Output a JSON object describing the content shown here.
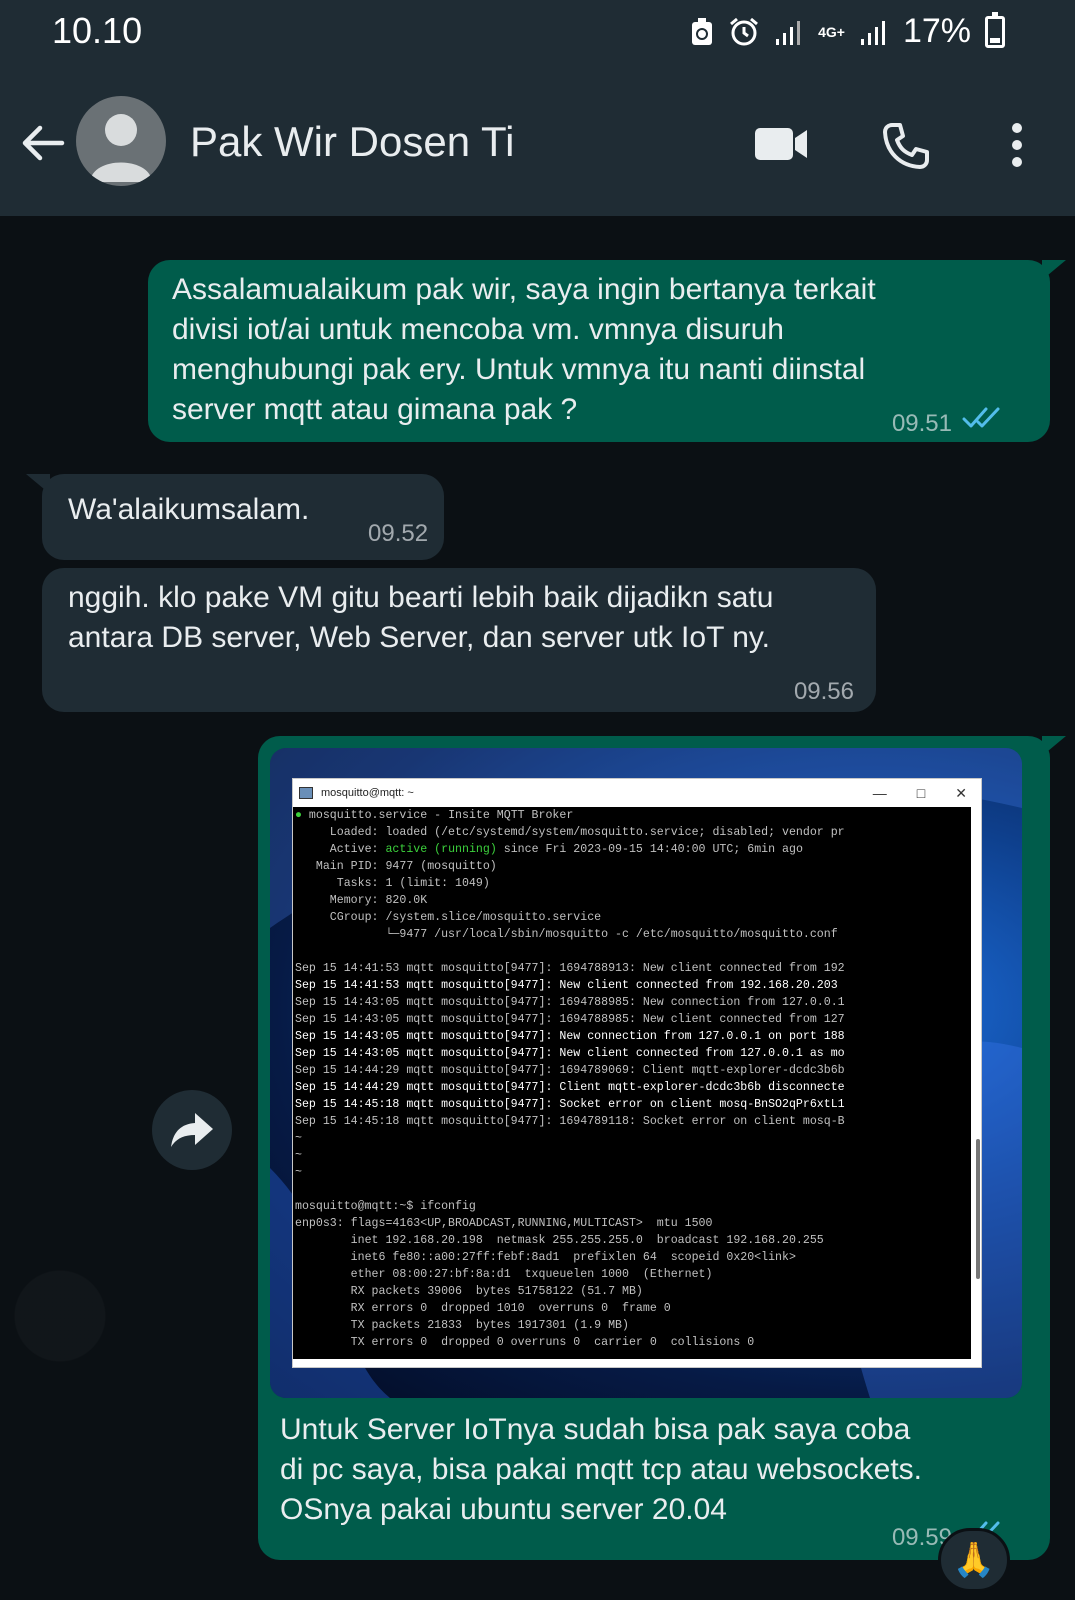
{
  "status_bar": {
    "time": "10.10",
    "network": "4G+",
    "battery": "17%"
  },
  "header": {
    "contact_name": "Pak Wir Dosen Ti",
    "icons": [
      "back-arrow-icon",
      "avatar",
      "video-call-icon",
      "phone-call-icon",
      "more-options-icon"
    ]
  },
  "messages": [
    {
      "direction": "outgoing",
      "lines": [
        "Assalamualaikum pak wir, saya ingin bertanya terkait",
        "divisi iot/ai untuk mencoba vm. vmnya disuruh",
        "menghubungi pak ery. Untuk vmnya itu nanti diinstal",
        "server mqtt atau gimana pak ?"
      ],
      "time": "09.51",
      "status": "read"
    },
    {
      "direction": "incoming",
      "lines": [
        "Wa'alaikumsalam."
      ],
      "time": "09.52"
    },
    {
      "direction": "incoming",
      "lines": [
        "nggih. klo pake VM gitu bearti lebih baik dijadikn satu",
        "antara DB server, Web Server, dan server utk IoT ny."
      ],
      "time": "09.56"
    },
    {
      "direction": "outgoing",
      "lines": [
        "Untuk Server IoTnya sudah bisa pak saya coba",
        "di pc saya, bisa pakai mqtt tcp atau websockets.",
        "OSnya pakai ubuntu server 20.04"
      ],
      "time": "09.59",
      "status": "read",
      "reaction": "🙏"
    }
  ],
  "terminal": {
    "title": "mosquitto@mqtt: ~",
    "lines": [
      "● mosquitto.service - Insite MQTT Broker",
      "     Loaded: loaded (/etc/systemd/system/mosquitto.service; disabled; vendor pr",
      "     Active: active (running) since Fri 2023-09-15 14:40:00 UTC; 6min ago",
      "   Main PID: 9477 (mosquitto)",
      "      Tasks: 1 (limit: 1049)",
      "     Memory: 820.0K",
      "     CGroup: /system.slice/mosquitto.service",
      "             └─9477 /usr/local/sbin/mosquitto -c /etc/mosquitto/mosquitto.conf",
      "",
      "Sep 15 14:41:53 mqtt mosquitto[9477]: 1694788913: New client connected from 192",
      "Sep 15 14:41:53 mqtt mosquitto[9477]: New client connected from 192.168.20.203",
      "Sep 15 14:43:05 mqtt mosquitto[9477]: 1694788985: New connection from 127.0.0.1",
      "Sep 15 14:43:05 mqtt mosquitto[9477]: 1694788985: New client connected from 127",
      "Sep 15 14:43:05 mqtt mosquitto[9477]: New connection from 127.0.0.1 on port 188",
      "Sep 15 14:43:05 mqtt mosquitto[9477]: New client connected from 127.0.0.1 as mo",
      "Sep 15 14:44:29 mqtt mosquitto[9477]: 1694789069: Client mqtt-explorer-dcdc3b6b",
      "Sep 15 14:44:29 mqtt mosquitto[9477]: Client mqtt-explorer-dcdc3b6b disconnecte",
      "Sep 15 14:45:18 mqtt mosquitto[9477]: Socket error on client mosq-BnSO2qPr6xtL1",
      "Sep 15 14:45:18 mqtt mosquitto[9477]: 1694789118: Socket error on client mosq-B",
      "~",
      "~",
      "~",
      "",
      "mosquitto@mqtt:~$ ifconfig",
      "enp0s3: flags=4163<UP,BROADCAST,RUNNING,MULTICAST>  mtu 1500",
      "        inet 192.168.20.198  netmask 255.255.255.0  broadcast 192.168.20.255",
      "        inet6 fe80::a00:27ff:febf:8ad1  prefixlen 64  scopeid 0x20<link>",
      "        ether 08:00:27:bf:8a:d1  txqueuelen 1000  (Ethernet)",
      "        RX packets 39006  bytes 51758122 (51.7 MB)",
      "        RX errors 0  dropped 1010  overruns 0  frame 0",
      "        TX packets 21833  bytes 1917301 (1.9 MB)",
      "        TX errors 0  dropped 0 overruns 0  carrier 0  collisions 0"
    ],
    "bright_lines": [
      10,
      13,
      14,
      16,
      17
    ]
  },
  "colors": {
    "header_bg": "#1f2c34",
    "chat_bg": "#0b1014",
    "outgoing_bubble": "#005c4b",
    "incoming_bubble": "#1f2c34",
    "read_ticks": "#53bdeb"
  }
}
